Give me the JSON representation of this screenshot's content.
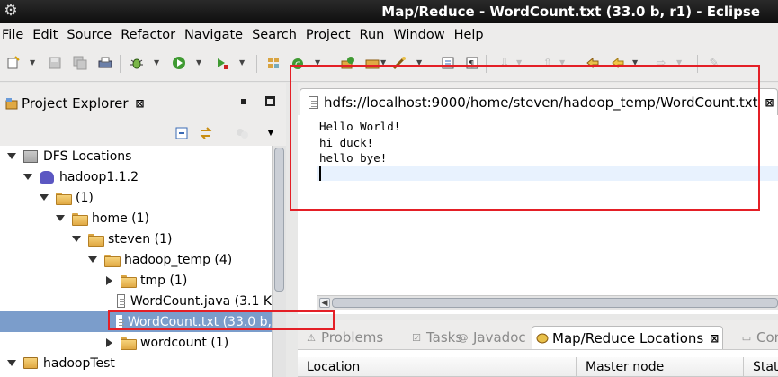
{
  "window": {
    "title": "Map/Reduce - WordCount.txt (33.0 b, r1) - Eclipse"
  },
  "menu": [
    {
      "label": "File",
      "mnemonic": "F",
      "rest": "ile"
    },
    {
      "label": "Edit",
      "mnemonic": "E",
      "rest": "dit"
    },
    {
      "label": "Source",
      "mnemonic": "S",
      "rest": "ource"
    },
    {
      "label": "Refactor",
      "mnemonic": "",
      "rest": "Refactor"
    },
    {
      "label": "Navigate",
      "mnemonic": "N",
      "rest": "avigate"
    },
    {
      "label": "Search",
      "mnemonic": "",
      "rest": "Search"
    },
    {
      "label": "Project",
      "mnemonic": "P",
      "rest": "roject"
    },
    {
      "label": "Run",
      "mnemonic": "R",
      "rest": "un"
    },
    {
      "label": "Window",
      "mnemonic": "W",
      "rest": "indow"
    },
    {
      "label": "Help",
      "mnemonic": "H",
      "rest": "elp"
    }
  ],
  "project_explorer": {
    "tab_label": "Project Explorer",
    "close_glyph": "⊠",
    "tree": [
      {
        "label": "DFS Locations",
        "level": 0,
        "twist": "down",
        "icon": "dfs-icon"
      },
      {
        "label": "hadoop1.1.2",
        "level": 1,
        "twist": "down",
        "icon": "elephant-icon"
      },
      {
        "label": "(1)",
        "level": 2,
        "twist": "down",
        "icon": "folder-icon"
      },
      {
        "label": "home (1)",
        "level": 3,
        "twist": "down",
        "icon": "folder-icon"
      },
      {
        "label": "steven (1)",
        "level": 4,
        "twist": "down",
        "icon": "folder-icon"
      },
      {
        "label": "hadoop_temp (4)",
        "level": 5,
        "twist": "down",
        "icon": "folder-icon"
      },
      {
        "label": "tmp (1)",
        "level": 6,
        "twist": "right",
        "icon": "folder-icon"
      },
      {
        "label": "WordCount.java (3.1 K",
        "level": 6,
        "twist": "none",
        "icon": "file-icon"
      },
      {
        "label": "WordCount.txt (33.0 b,",
        "level": 6,
        "twist": "none",
        "icon": "file-icon",
        "selected": true
      },
      {
        "label": "wordcount (1)",
        "level": 6,
        "twist": "right",
        "icon": "folder-icon"
      },
      {
        "label": "hadoopTest",
        "level": 0,
        "twist": "down",
        "icon": "project-icon"
      }
    ]
  },
  "editor": {
    "tab_label": "hdfs://localhost:9000/home/steven/hadoop_temp/WordCount.txt",
    "close_glyph": "⊠",
    "content": "Hello World!\nhi duck!\nhello bye!"
  },
  "bottom_panel": {
    "tabs": [
      {
        "label": "Problems",
        "icon": "problems-icon",
        "glyph": "⚠",
        "active": false
      },
      {
        "label": "Tasks",
        "icon": "tasks-icon",
        "glyph": "☑",
        "active": false
      },
      {
        "label": "Javadoc",
        "icon": "javadoc-icon",
        "glyph": "@",
        "active": false
      },
      {
        "label": "Map/Reduce Locations",
        "icon": "elephant-icon",
        "glyph": "",
        "active": true
      },
      {
        "label": "Conso",
        "icon": "console-icon",
        "glyph": "▭",
        "active": false
      }
    ],
    "columns": [
      "Location",
      "Master node",
      "State"
    ]
  },
  "colors": {
    "selection": "#7b9dcb",
    "annotation": "#e41f26",
    "title_bar": "#1a1a1a"
  }
}
